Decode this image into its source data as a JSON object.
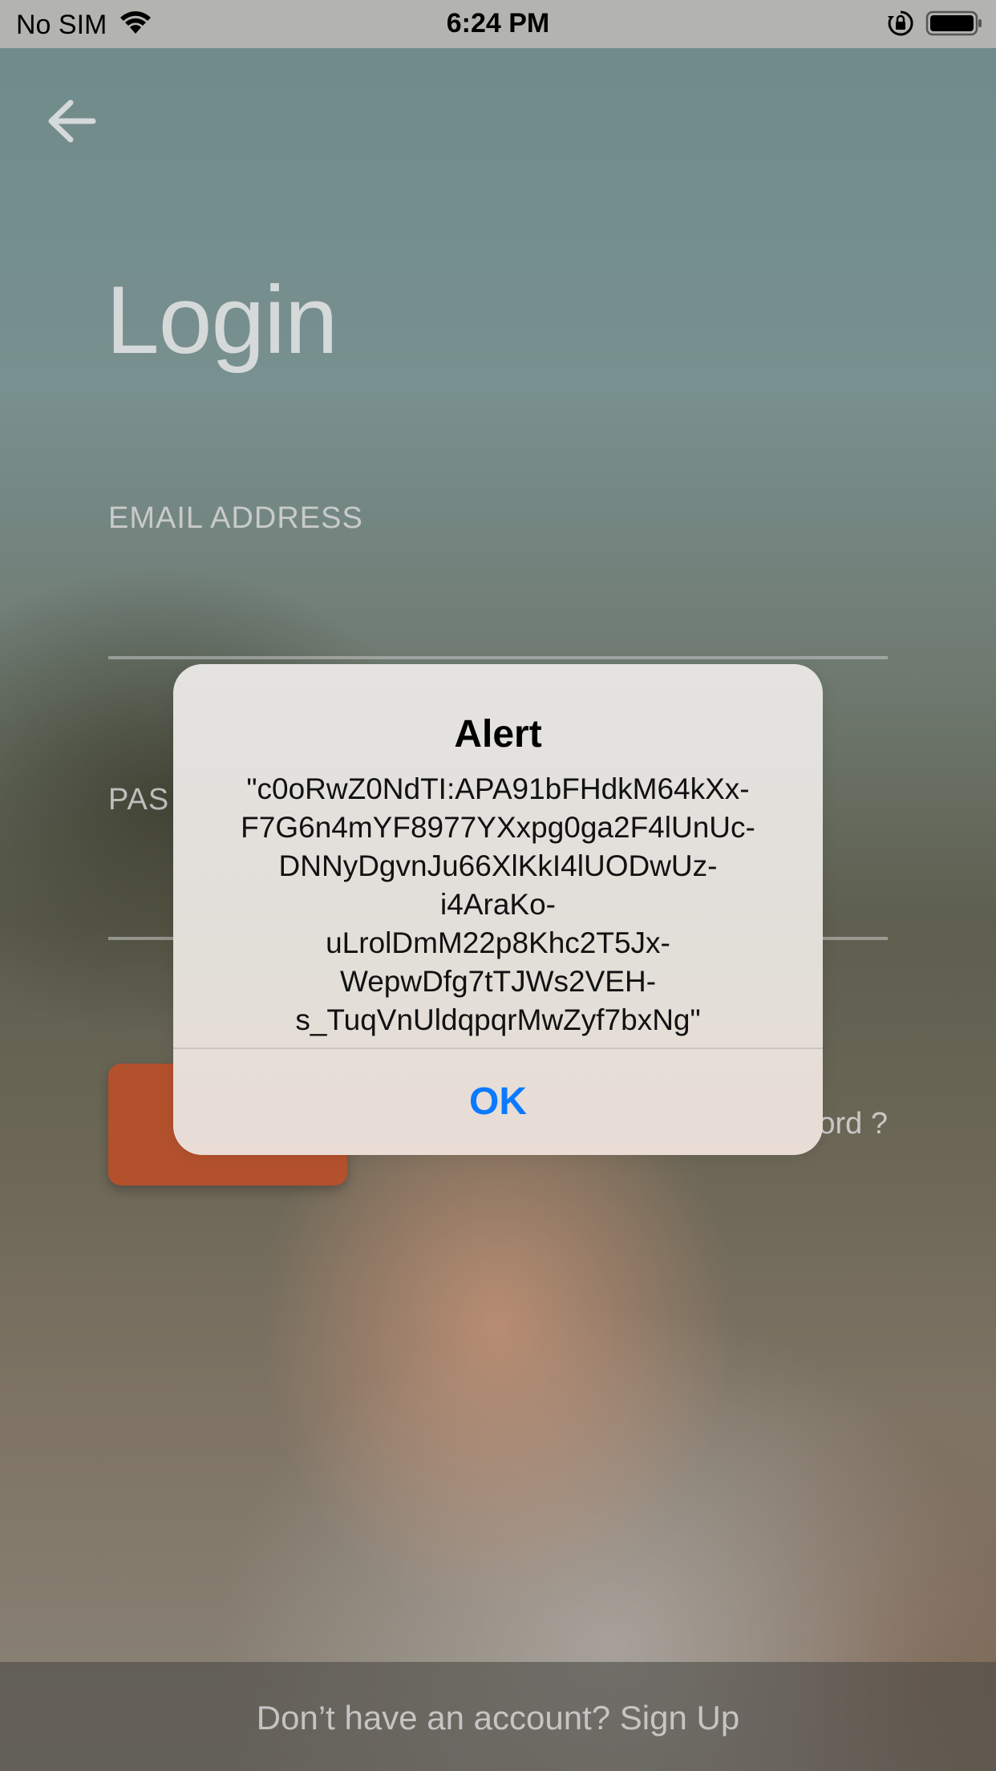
{
  "status_bar": {
    "carrier": "No SIM",
    "time": "6:24 PM",
    "icons": [
      "wifi-icon",
      "orientation-lock-icon",
      "battery-icon"
    ]
  },
  "login": {
    "title": "Login",
    "email_label": "EMAIL ADDRESS",
    "password_label_partial": "PAS",
    "forgot_partial": "ord ?",
    "signup_text": "Don’t have an account? Sign Up"
  },
  "alert": {
    "title": "Alert",
    "message": "\"c0oRwZ0NdTI:APA91bFHdkM64kXx-F7G6n4mYF8977YXxpg0ga2F4lUnUc-DNNyDgvnJu66XlKkI4lUODwUz-i4AraKo-uLrolDmM22p8Khc2T5Jx-WepwDfg7tTJWs2VEH-s_TuqVnUldqpqrMwZyf7bxNg\"",
    "ok_label": "OK"
  },
  "colors": {
    "accent_button": "#b4512d",
    "alert_action": "#0a7aff"
  }
}
